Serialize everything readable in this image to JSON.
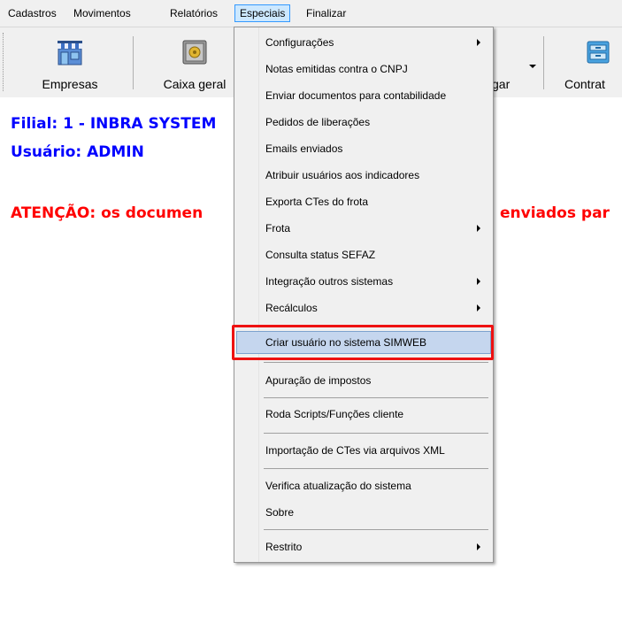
{
  "menubar": {
    "items": [
      {
        "label": "Cadastros",
        "accel": "d"
      },
      {
        "label": "Movimentos",
        "accel": "n"
      },
      {
        "label": "Relatórios",
        "accel": "l"
      },
      {
        "label": "Especiais",
        "accel": "s"
      },
      {
        "label": "Finalizar",
        "accel": "z"
      }
    ],
    "active": "Especiais"
  },
  "toolbar": {
    "buttons": [
      {
        "label": "Empresas",
        "icon": "store-icon"
      },
      {
        "label": "Caixa geral",
        "icon": "safe-icon"
      },
      {
        "label": "gar",
        "icon": "pay-icon"
      },
      {
        "label": "Contrat",
        "icon": "contracts-icon"
      }
    ]
  },
  "info": {
    "filial": "Filial: 1 - INBRA SYSTEM",
    "usuario": "Usuário: ADMIN",
    "atencao_left": "ATENÇÃO: os documen",
    "atencao_right": "enviados par"
  },
  "dropdown": {
    "items": [
      {
        "label": "Configurações",
        "submenu": true
      },
      {
        "label": "Notas emitidas contra o CNPJ",
        "submenu": false
      },
      {
        "label": "Enviar documentos para contabilidade",
        "submenu": false
      },
      {
        "label": "Pedidos de liberações",
        "submenu": false
      },
      {
        "label": "Emails enviados",
        "submenu": false
      },
      {
        "label": "Atribuir usuários aos indicadores",
        "submenu": false
      },
      {
        "label": "Exporta CTes do frota",
        "submenu": false
      },
      {
        "label": "Frota",
        "submenu": true
      },
      {
        "label": "Consulta status SEFAZ",
        "submenu": false
      },
      {
        "label": "Integração outros sistemas",
        "submenu": true
      },
      {
        "label": "Recálculos",
        "submenu": true
      },
      {
        "label": "Criar usuário no sistema SIMWEB",
        "submenu": false,
        "highlighted": true
      },
      {
        "label": "Apuração de impostos",
        "submenu": false
      },
      {
        "label": "Roda Scripts/Funções cliente",
        "submenu": false
      },
      {
        "label": "Importação de CTes via arquivos XML",
        "submenu": false
      },
      {
        "label": "Verifica atualização do sistema",
        "submenu": false
      },
      {
        "label": "Sobre",
        "submenu": false
      },
      {
        "label": "Restrito",
        "submenu": true
      }
    ]
  },
  "colors": {
    "info_blue": "#0000ff",
    "attention_red": "#ff0000",
    "highlight_box": "#ee1111",
    "menu_hover": "#c5d6ee"
  }
}
